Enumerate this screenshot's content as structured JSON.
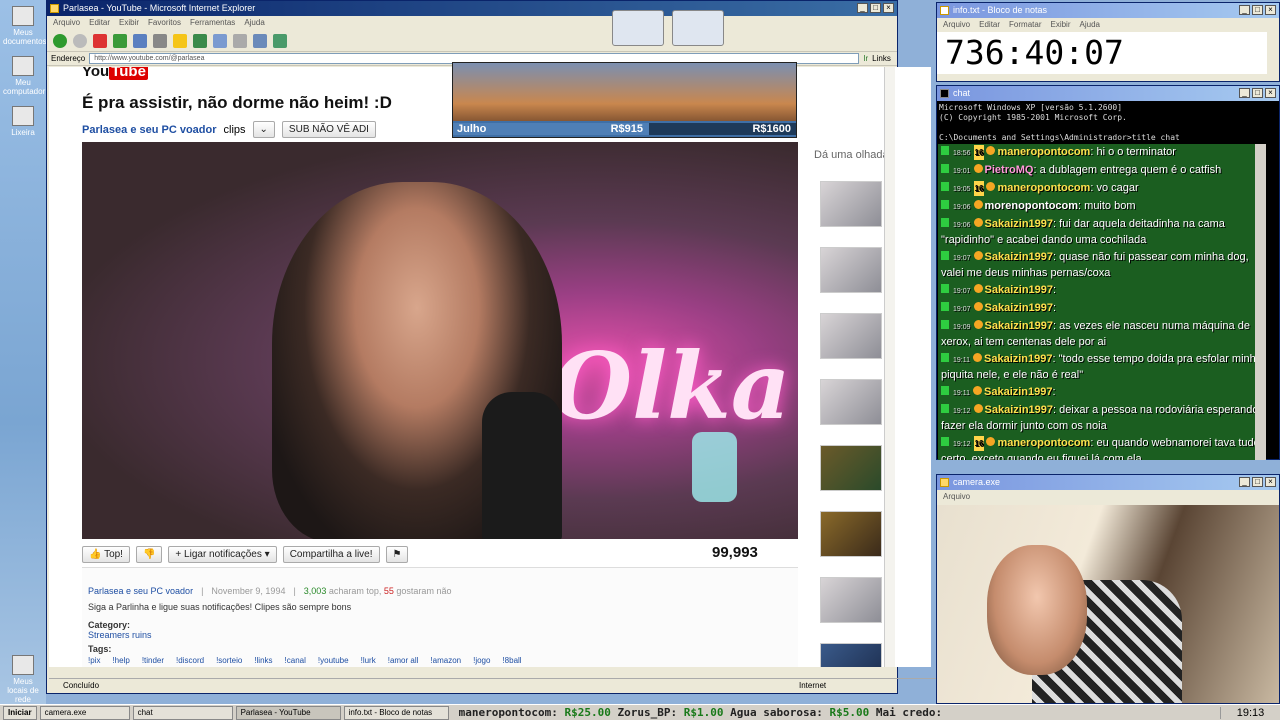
{
  "desktop": {
    "icons": [
      "Meus documentos",
      "Meu computador",
      "Lixeira",
      "Meus locais de rede"
    ]
  },
  "ie": {
    "title": "Parlasea - YouTube - Microsoft Internet Explorer",
    "menu": [
      "Arquivo",
      "Editar",
      "Exibir",
      "Favoritos",
      "Ferramentas",
      "Ajuda"
    ],
    "address_label": "Endereço",
    "url": "http://www.youtube.com/@parlasea",
    "go_label": "Ir",
    "links_label": "Links",
    "status": "Concluído",
    "zone": "Internet"
  },
  "yt": {
    "logo_you": "You",
    "logo_tube": "Tube",
    "video_title": "É pra assistir, não dorme não heim! :D",
    "channel": "Parlasea e seu PC voador",
    "clips_label": "clips",
    "sub_label": "SUB NÃO VÊ ADI",
    "like_label": "Top!",
    "notify_label": "Ligar notificações",
    "share_label": "Compartilha a live!",
    "views": "99,993",
    "neon": "Olka",
    "side_header": "Dá uma olhada",
    "desc": {
      "channel": "Parlasea e seu PC voador",
      "date": "November 9, 1994",
      "likes": "3,003",
      "likes_text": "acharam top,",
      "dislikes": "55",
      "dislikes_text": "gostaram não",
      "text": "Siga a Parlinha e ligue suas notificações! Clipes são sempre bons",
      "category_label": "Category:",
      "category": "Streamers ruins",
      "tags_label": "Tags:",
      "tags": [
        "!pix",
        "!help",
        "!tinder",
        "!discord",
        "!sorteio",
        "!links",
        "!canal",
        "!youtube",
        "!lurk",
        "!amor all",
        "!amazon",
        "!jogo",
        "!8ball"
      ]
    }
  },
  "overlay": {
    "month": "Julho",
    "goal_current": "R$915",
    "goal_total": "R$1600"
  },
  "notepad": {
    "title": "info.txt - Bloco de notas",
    "menu": [
      "Arquivo",
      "Editar",
      "Formatar",
      "Exibir",
      "Ajuda"
    ],
    "timer": "736:40:07"
  },
  "cmd": {
    "title": "chat",
    "lines": [
      "Microsoft Windows XP [versão 5.1.2600]",
      "(C) Copyright 1985-2001 Microsoft Corp.",
      "",
      "C:\\Documents and Settings\\Administrador>title chat",
      "",
      "C:\\Documents and Settings\\Administrador>chat start"
    ]
  },
  "chat": [
    {
      "time": "18:56",
      "badge": "16",
      "user": "maneropontocom",
      "text": "hi o o terminator",
      "c": ""
    },
    {
      "time": "19:01",
      "badge": "",
      "user": "PietroMQ",
      "text": "a dublagem entrega quem é o catfish",
      "c": "p"
    },
    {
      "time": "19:05",
      "badge": "16",
      "user": "maneropontocom",
      "text": "vo cagar",
      "c": ""
    },
    {
      "time": "19:06",
      "badge": "",
      "user": "morenopontocom",
      "text": "muito bom",
      "c": "w"
    },
    {
      "time": "19:06",
      "badge": "",
      "user": "Sakaizin1997",
      "text": "fui dar aquela deitadinha na cama \"rapidinho\" e acabei dando uma cochilada",
      "c": ""
    },
    {
      "time": "19:07",
      "badge": "",
      "user": "Sakaizin1997",
      "text": "quase não fui passear com minha dog, valei me deus minhas pernas/coxa",
      "c": ""
    },
    {
      "time": "19:07",
      "badge": "",
      "user": "Sakaizin1997",
      "text": "",
      "c": ""
    },
    {
      "time": "19:07",
      "badge": "",
      "user": "Sakaizin1997",
      "text": "",
      "c": ""
    },
    {
      "time": "19:09",
      "badge": "",
      "user": "Sakaizin1997",
      "text": "as vezes ele nasceu numa máquina de xerox, ai tem centenas dele por ai",
      "c": ""
    },
    {
      "time": "19:11",
      "badge": "",
      "user": "Sakaizin1997",
      "text": "\"todo esse tempo doida pra esfolar minha piquita nele, e ele não é real\"",
      "c": ""
    },
    {
      "time": "19:11",
      "badge": "",
      "user": "Sakaizin1997",
      "text": "",
      "c": ""
    },
    {
      "time": "19:12",
      "badge": "",
      "user": "Sakaizin1997",
      "text": "deixar a pessoa na rodoviária esperando, fazer ela dormir junto com os noia",
      "c": ""
    },
    {
      "time": "19:12",
      "badge": "16",
      "user": "maneropontocom",
      "text": "eu quando webnamorei tava tudo certo, exceto quando eu fiquei lá com ela",
      "c": ""
    }
  ],
  "camera": {
    "title": "camera.exe",
    "menu": "Arquivo"
  },
  "taskbar": {
    "start": "Iniciar",
    "buttons": [
      "camera.exe",
      "chat",
      "Parlasea - YouTube",
      "info.txt - Bloco de notas"
    ],
    "ticker": [
      {
        "user": "maneropontocom:",
        "amount": "R$25.00"
      },
      {
        "user": "Zorus_BP:",
        "amount": "R$1.00"
      },
      {
        "user": "Agua saborosa:",
        "amount": "R$5.00"
      },
      {
        "user": "Mai credo:",
        "amount": ""
      }
    ],
    "clock": "19:13"
  }
}
